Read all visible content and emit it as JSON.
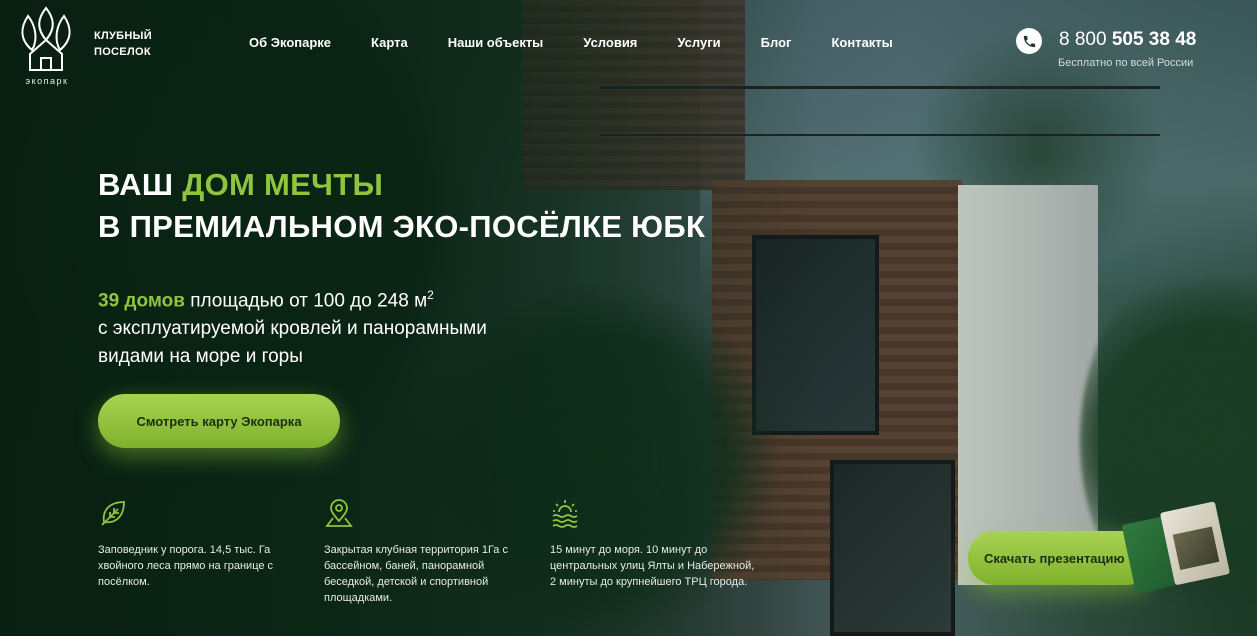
{
  "logo": {
    "text": "экопарк",
    "icon": "eco-house-tree-logo"
  },
  "club": {
    "line1": "КЛУБНЫЙ",
    "line2": "ПОСЕЛОК"
  },
  "nav": [
    {
      "label": "Об Экопарке"
    },
    {
      "label": "Карта"
    },
    {
      "label": "Наши объекты"
    },
    {
      "label": "Условия"
    },
    {
      "label": "Услуги"
    },
    {
      "label": "Блог"
    },
    {
      "label": "Контакты"
    }
  ],
  "contact": {
    "phone_prefix": "8 800",
    "phone_main": "505 38 48",
    "phone_note": "Бесплатно по всей России",
    "icon": "phone-icon"
  },
  "hero": {
    "title_part1": "ВАШ ",
    "title_accent": "ДОМ МЕЧТЫ",
    "title_line2": "В ПРЕМИАЛЬНОМ ЭКО-ПОСЁЛКЕ ЮБК",
    "lead_accent": "39 домов",
    "lead_part1": " площадью от 100 до 248 м",
    "lead_sup": "2",
    "lead_line2": "с эксплуатируемой кровлей и панорамными",
    "lead_line3": "видами на море и горы",
    "cta_label": "Смотреть карту Экопарка"
  },
  "features": [
    {
      "icon": "leaf-icon",
      "text": "Заповедник у порога. 14,5 тыс. Га хвойного леса прямо на границе с посёлком."
    },
    {
      "icon": "map-pin-icon",
      "text": "Закрытая клубная территория 1Га с бассейном, баней, панорамной беседкой, детской и спортивной площадками."
    },
    {
      "icon": "sun-sea-icon",
      "text": "15 минут до моря. 10 минут до центральных улиц Ялты и Набережной, 2 минуты до крупнейшего ТРЦ города."
    }
  ],
  "presentation": {
    "label": "Скачать презентацию"
  },
  "colors": {
    "accent": "#8fc43f",
    "button": "#9ccc47",
    "button_text": "#203015"
  }
}
